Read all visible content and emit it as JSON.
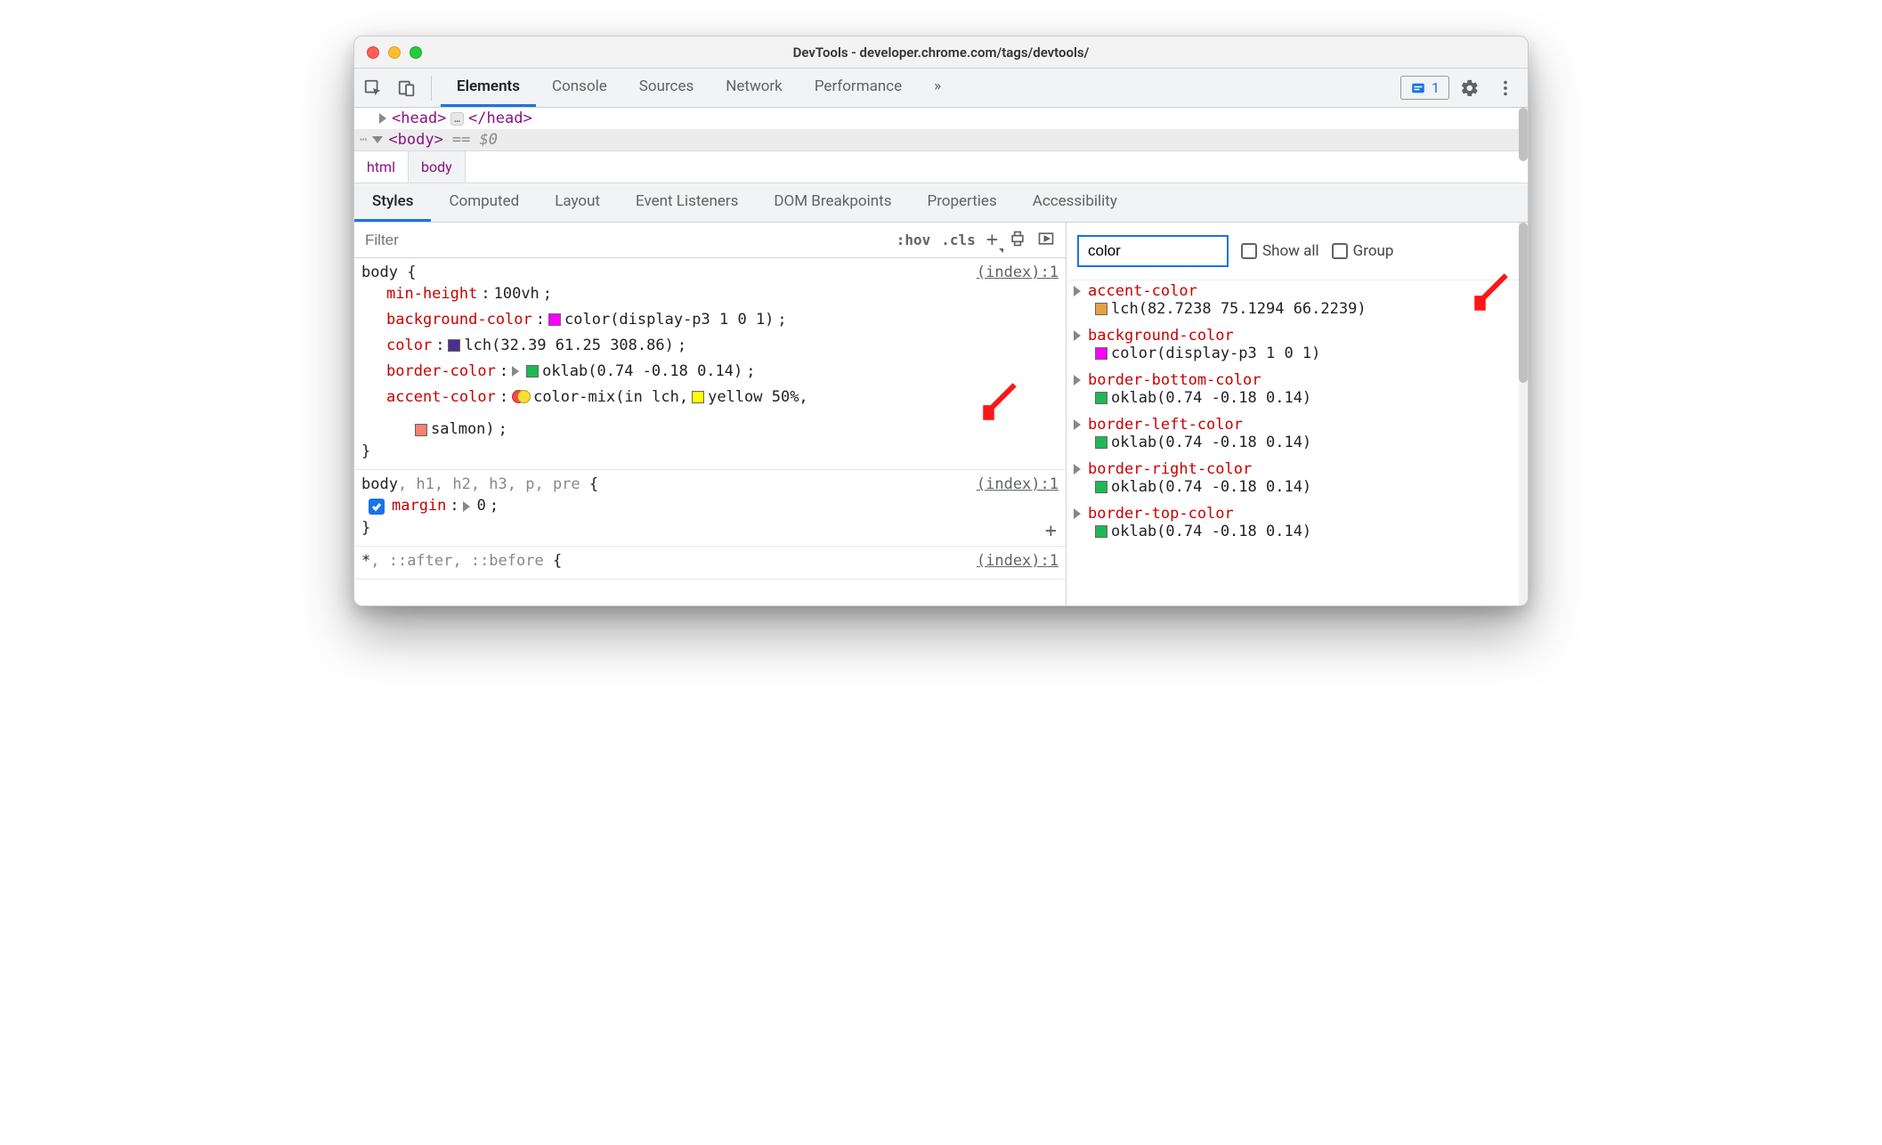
{
  "window": {
    "title": "DevTools - developer.chrome.com/tags/devtools/"
  },
  "main_tabs": {
    "items": [
      "Elements",
      "Console",
      "Sources",
      "Network",
      "Performance"
    ],
    "more": "»",
    "issues_count": "1"
  },
  "dom": {
    "head_open": "<head>",
    "head_close": "</head>",
    "body_open": "<body>",
    "selection_expr": "== $0",
    "dots": "…"
  },
  "breadcrumb": {
    "items": [
      "html",
      "body"
    ]
  },
  "subtabs": {
    "items": [
      "Styles",
      "Computed",
      "Layout",
      "Event Listeners",
      "DOM Breakpoints",
      "Properties",
      "Accessibility"
    ]
  },
  "styles_toolbar": {
    "filter_placeholder": "Filter",
    "hov": ":hov",
    "cls": ".cls",
    "plus": "+"
  },
  "rules": [
    {
      "selector": "body",
      "source": "(index):1",
      "declarations": [
        {
          "prop": "min-height",
          "value_plain": "100vh"
        },
        {
          "prop": "background-color",
          "swatch": "magenta",
          "value_plain": "color(display-p3 1 0 1)"
        },
        {
          "prop": "color",
          "swatch": "purple",
          "value_plain": "lch(32.39 61.25 308.86)"
        },
        {
          "prop": "border-color",
          "expandable": true,
          "swatch": "green",
          "value_plain": "oklab(0.74 -0.18 0.14)"
        },
        {
          "prop": "accent-color",
          "colormix": true,
          "value_prefix": "color-mix(in lch, ",
          "swatch_mid": "yellow",
          "mid_text": "yellow 50%,",
          "swatch_mid2": "salmon",
          "mid2_text": "salmon)"
        }
      ]
    },
    {
      "selector_rich": "body, h1, h2, h3, p, pre",
      "source": "(index):1",
      "declarations": [
        {
          "checked": true,
          "prop": "margin",
          "expandable": true,
          "value_plain": "0"
        }
      ]
    },
    {
      "selector_rich": "*, ::after, ::before",
      "source": "(index):1",
      "declarations": []
    }
  ],
  "computed": {
    "filter_value": "color",
    "show_all": "Show all",
    "group": "Group",
    "items": [
      {
        "prop": "accent-color",
        "swatch": "orange",
        "value": "lch(82.7238 75.1294 66.2239)"
      },
      {
        "prop": "background-color",
        "swatch": "magenta",
        "value": "color(display-p3 1 0 1)"
      },
      {
        "prop": "border-bottom-color",
        "swatch": "green",
        "value": "oklab(0.74 -0.18 0.14)"
      },
      {
        "prop": "border-left-color",
        "swatch": "green",
        "value": "oklab(0.74 -0.18 0.14)"
      },
      {
        "prop": "border-right-color",
        "swatch": "green",
        "value": "oklab(0.74 -0.18 0.14)"
      },
      {
        "prop": "border-top-color",
        "swatch": "green",
        "value": "oklab(0.74 -0.18 0.14)"
      }
    ]
  }
}
